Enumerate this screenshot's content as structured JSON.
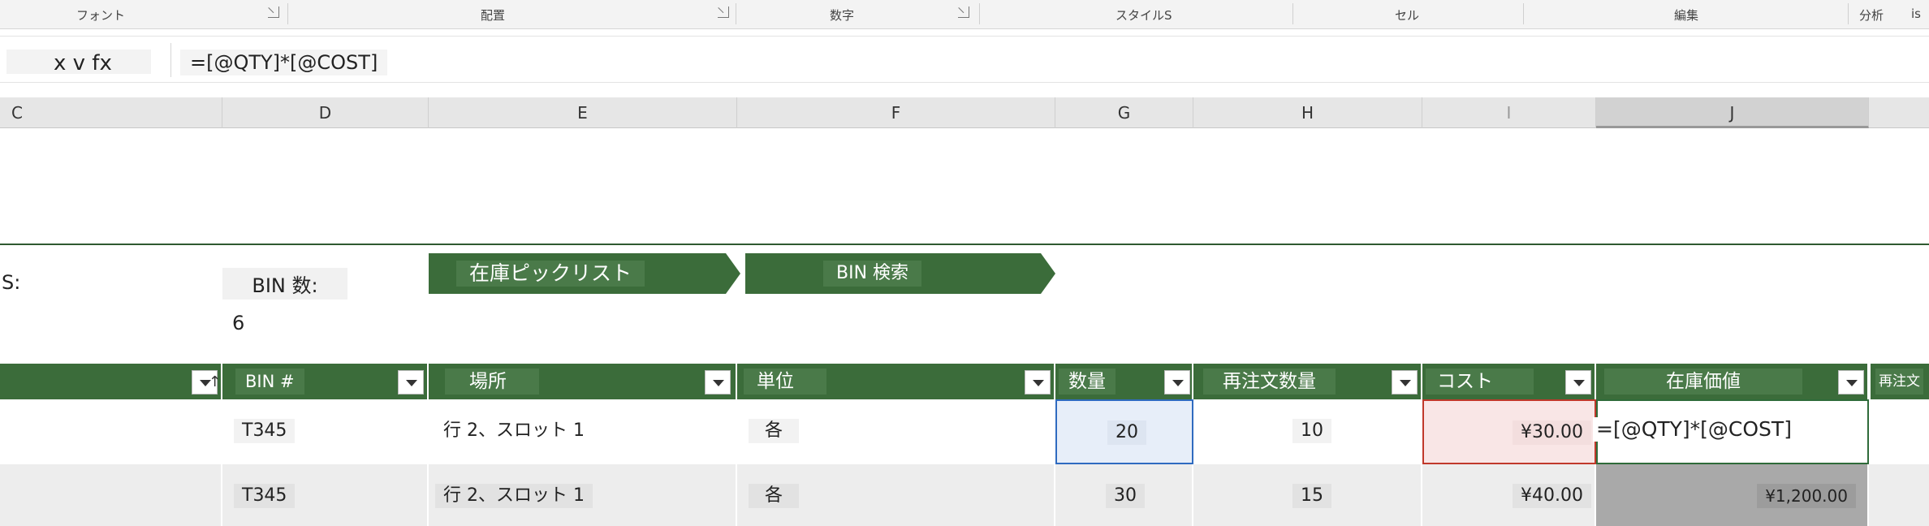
{
  "ribbon": {
    "groups": [
      "フォント",
      "配置",
      "数字",
      "スタイルS",
      "セル",
      "編集",
      "分析",
      "is"
    ]
  },
  "formula_bar": {
    "name_box": "",
    "fx_label": "x v fx",
    "formula": "=[@QTY]*[@COST]"
  },
  "columns": [
    "C",
    "D",
    "E",
    "F",
    "G",
    "H",
    "I",
    "J"
  ],
  "labels": {
    "s_label": "S:",
    "bin_count_label": "BIN 数:",
    "bin_count_value": "6"
  },
  "nav_buttons": {
    "picklist": "在庫ピックリスト",
    "bin_search": "BIN 検索"
  },
  "table": {
    "headers": [
      "BIN #",
      "場所",
      "単位",
      "数量",
      "再注文数量",
      "コスト",
      "在庫価値",
      "再注文"
    ],
    "rows": [
      {
        "bin": "T345",
        "location": "行 2、スロット 1",
        "unit": "各",
        "qty": "20",
        "reorder_qty": "10",
        "cost": "¥30.00",
        "value": "=[@QTY]*[@COST]"
      },
      {
        "bin": "T345",
        "location": "行 2、スロット 1",
        "unit": "各",
        "qty": "30",
        "reorder_qty": "15",
        "cost": "¥40.00",
        "value": "¥1,200.00"
      }
    ]
  },
  "colors": {
    "accent_green": "#3b6c3a",
    "edit_cell_border": "#2f6b3a",
    "qty_selected": "#e7eef9",
    "cost_selected": "#f9e6e6"
  }
}
